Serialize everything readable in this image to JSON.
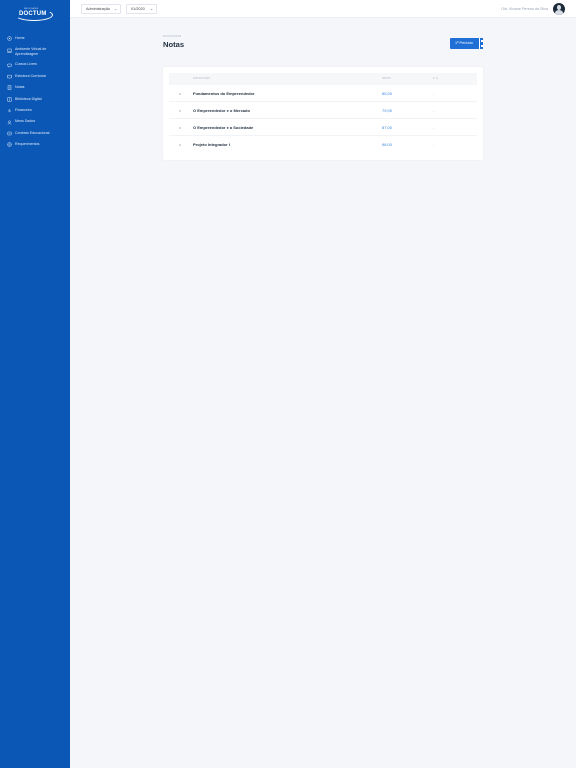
{
  "sidebar": {
    "logo": {
      "prefix": "FACULDADES",
      "name": "DOCTUM"
    },
    "items": [
      {
        "label": "Home",
        "icon": "home-icon"
      },
      {
        "label": "Ambiente Virtual de Aprendizagem",
        "icon": "laptop-icon"
      },
      {
        "label": "Cursos Livres",
        "icon": "chat-icon"
      },
      {
        "label": "Estrutura Curricular",
        "icon": "book-icon"
      },
      {
        "label": "Notas",
        "icon": "clipboard-icon"
      },
      {
        "label": "Biblioteca Digital",
        "icon": "library-icon"
      },
      {
        "label": "Financeiro",
        "icon": "dollar-icon"
      },
      {
        "label": "Meus Dados",
        "icon": "user-icon"
      },
      {
        "label": "Contrato Educacional",
        "icon": "document-icon"
      },
      {
        "label": "Requerimentos",
        "icon": "settings-icon"
      }
    ]
  },
  "topbar": {
    "course_select": "Administração",
    "period_select": "01/2020",
    "user_name": "Ola, Viviane Pereira da Silva"
  },
  "header": {
    "breadcrumb": "DISCIPLINAS",
    "title": "Notas",
    "period_button": "1º Período"
  },
  "table": {
    "headers": [
      "DISCIPLINAS",
      "NOTAS",
      "F. A."
    ],
    "rows": [
      {
        "subject": "Fundamentos do Empreendedor",
        "grade": "85,00",
        "absences": "-"
      },
      {
        "subject": "O Empreendedor e o Mercado",
        "grade": "79,00",
        "absences": "-"
      },
      {
        "subject": "O Empreendedor e a Sociedade",
        "grade": "87,00",
        "absences": "-"
      },
      {
        "subject": "Projeto Integrador I",
        "grade": "98,00",
        "absences": "-"
      }
    ]
  },
  "colors": {
    "sidebar": "#0a57b5",
    "accent": "#1f6fd6",
    "grade": "#3a86e0"
  }
}
